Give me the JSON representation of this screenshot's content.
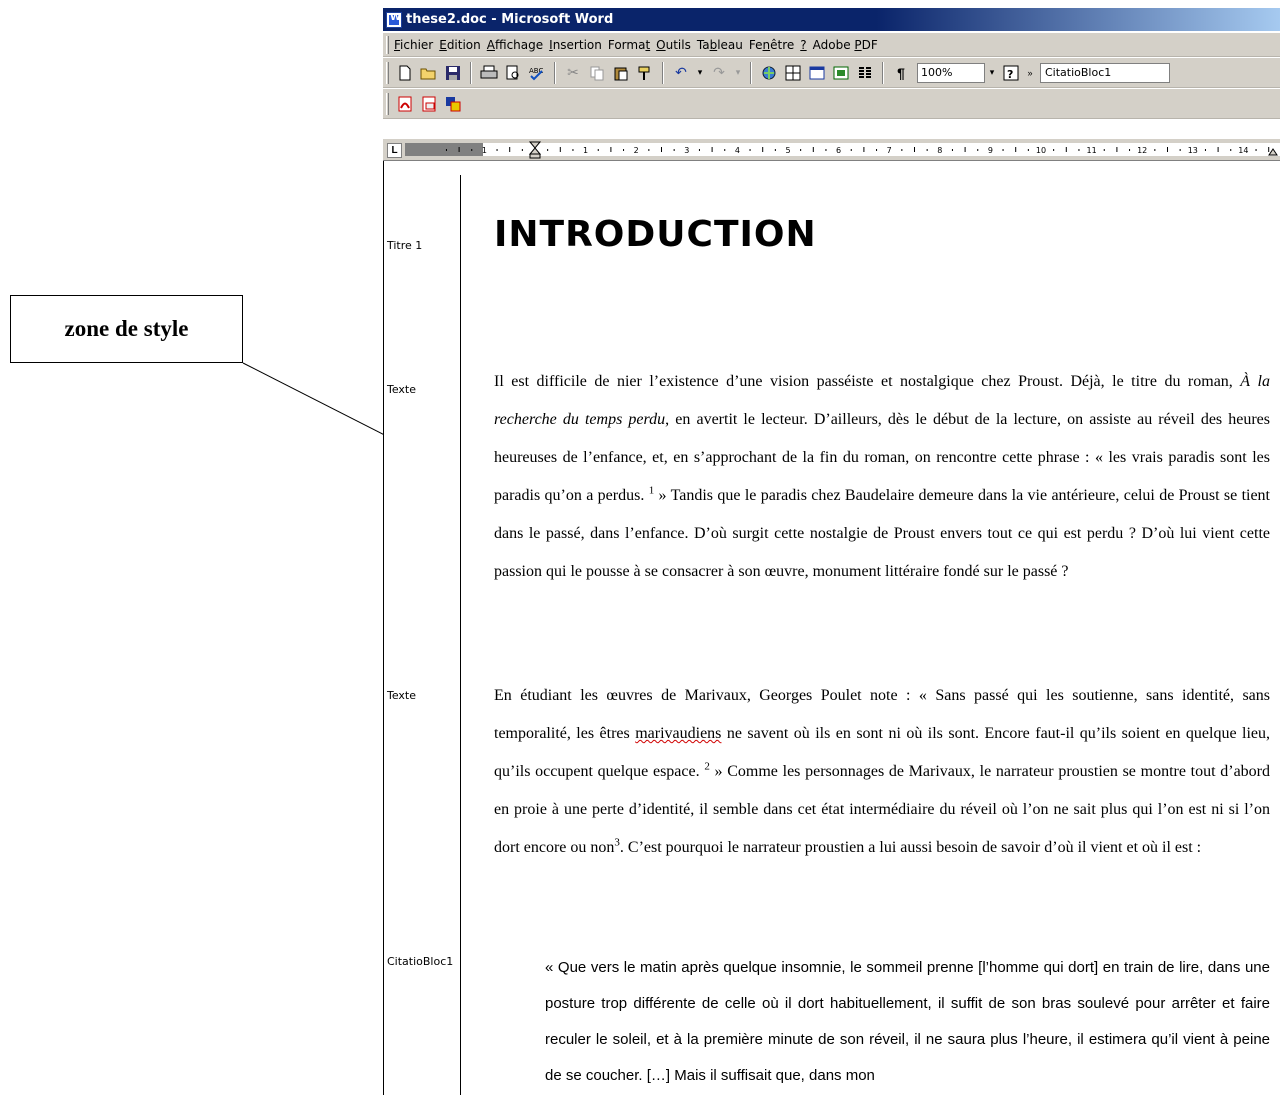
{
  "callout": {
    "label": "zone de style"
  },
  "window": {
    "title": "these2.doc - Microsoft Word"
  },
  "menu": {
    "items": [
      {
        "pre": "",
        "key": "F",
        "post": "ichier"
      },
      {
        "pre": "",
        "key": "E",
        "post": "dition"
      },
      {
        "pre": "",
        "key": "A",
        "post": "ffichage"
      },
      {
        "pre": "",
        "key": "I",
        "post": "nsertion"
      },
      {
        "pre": "Forma",
        "key": "t",
        "post": ""
      },
      {
        "pre": "",
        "key": "O",
        "post": "utils"
      },
      {
        "pre": "Ta",
        "key": "b",
        "post": "leau"
      },
      {
        "pre": "Fe",
        "key": "n",
        "post": "être"
      },
      {
        "pre": "",
        "key": "?",
        "post": ""
      },
      {
        "pre": "Adobe ",
        "key": "P",
        "post": "DF"
      }
    ]
  },
  "toolbar": {
    "zoom": "100%",
    "style": "CitatioBloc1",
    "icons": [
      "new-document-icon",
      "open-folder-icon",
      "save-icon",
      "print-icon",
      "print-preview-icon",
      "spelling-icon",
      "cut-icon",
      "copy-icon",
      "paste-icon",
      "format-painter-icon",
      "undo-icon",
      "redo-icon",
      "hyperlink-icon",
      "tables-borders-icon",
      "insert-table-icon",
      "insert-excel-icon",
      "columns-icon",
      "show-formatting-icon",
      "help-icon"
    ]
  },
  "toolbar2": {
    "icons": [
      "pdf-convert-icon",
      "pdf-email-icon",
      "pdf-review-icon"
    ]
  },
  "ruler": {
    "labels": [
      "1",
      "1",
      "2",
      "3",
      "4",
      "5",
      "6",
      "7",
      "8",
      "9",
      "10",
      "11",
      "12",
      "13",
      "14",
      "15"
    ]
  },
  "style_area": {
    "labels": [
      {
        "id": "s1",
        "text": "Titre 1"
      },
      {
        "id": "s2",
        "text": "Texte"
      },
      {
        "id": "s3",
        "text": "Texte"
      },
      {
        "id": "s4",
        "text": "CitatioBloc1"
      }
    ]
  },
  "document": {
    "title": "INTRODUCTION",
    "p1": {
      "a": "Il est difficile de nier l’existence d’une vision passéiste et nostalgique chez Proust. Déjà, le titre du roman, ",
      "italic": "À la recherche du temps perdu",
      "b": ", en avertit le lecteur. D’ailleurs, dès le début de la lecture, on assiste au réveil des heures heureuses de l’enfance, et, en s’approchant de la fin du roman, on rencontre cette phrase : « les vrais paradis sont les paradis qu’on a perdus. ",
      "fn1": "1",
      "c": " » Tandis que le paradis chez Baudelaire demeure dans la vie antérieure, celui de Proust se tient dans le passé, dans l’enfance. D’où surgit cette nostalgie de Proust envers tout ce qui est perdu ? D’où lui vient cette passion qui le pousse à se consacrer à son œuvre, monument littéraire fondé sur le passé ?"
    },
    "p2": {
      "a": "En étudiant les œuvres de Marivaux, Georges Poulet note : « Sans passé qui les soutienne, sans identité, sans temporalité, les êtres ",
      "misspelled": "marivaudiens",
      "b": " ne savent où ils en sont ni où ils sont. Encore faut-il qu’ils soient en quelque lieu, qu’ils occupent quelque espace. ",
      "fn2": "2",
      "c": " » Comme les personnages de Marivaux, le narrateur proustien se montre tout d’abord en proie à une perte d’identité, il semble dans cet état intermédiaire du réveil où l’on ne sait plus qui l’on est ni si l’on dort encore ou non",
      "fn3": "3",
      "d": ". C’est pourquoi le narrateur proustien a lui aussi besoin de savoir d’où il vient et où il est :"
    },
    "quote": "« Que vers le matin après quelque insomnie, le sommeil prenne [l’homme qui dort] en train de lire, dans une posture trop différente de celle où il dort habituellement, il suffit de son bras soulevé pour arrêter et faire reculer le soleil, et à la première minute de son réveil, il ne saura plus l’heure, il estimera qu’il vient à peine de se coucher. […] Mais il suffisait que, dans mon"
  }
}
